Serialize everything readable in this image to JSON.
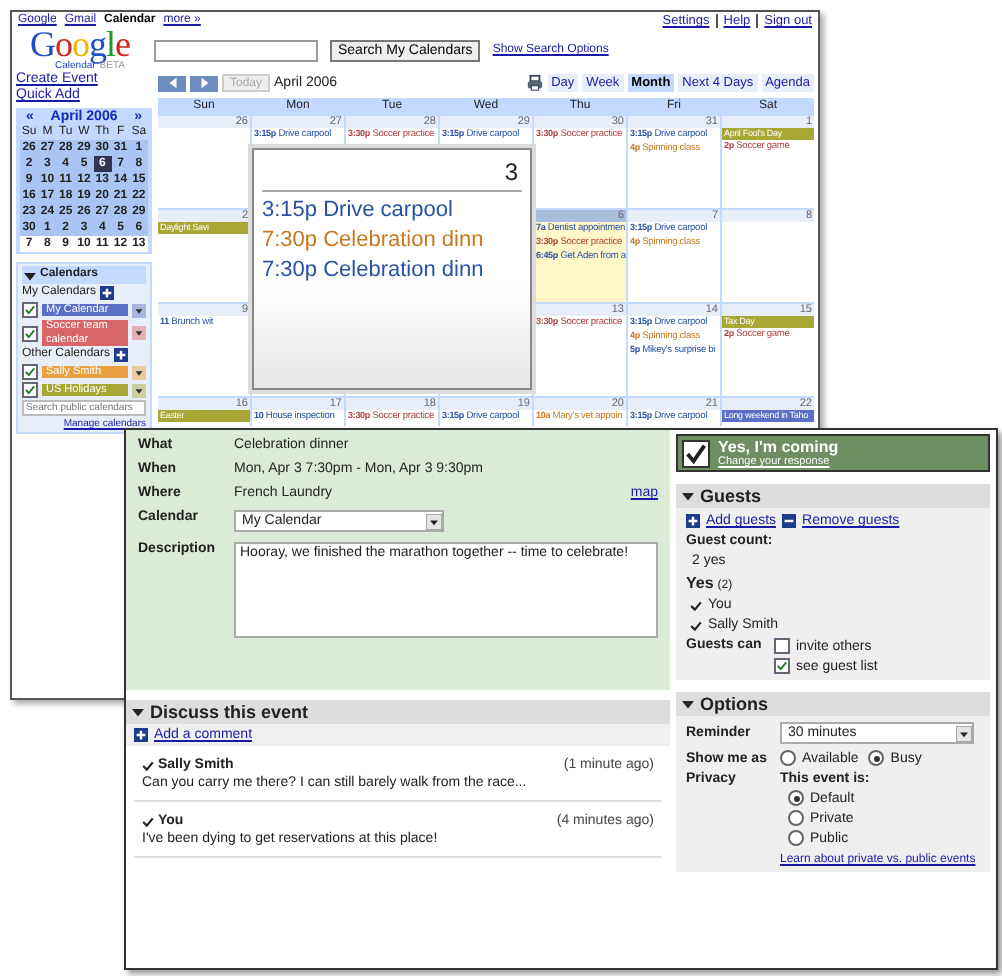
{
  "top_links": [
    {
      "label": "Google",
      "selected": false
    },
    {
      "label": "Gmail",
      "selected": false
    },
    {
      "label": "Calendar",
      "selected": true
    },
    {
      "label": "more »",
      "selected": false
    }
  ],
  "account_links": [
    "Settings",
    "Help",
    "Sign out"
  ],
  "logo": {
    "name": "Google",
    "subtitle": "Calendar",
    "badge": "BETA"
  },
  "search": {
    "button": "Search My Calendars",
    "options_link": "Show Search Options"
  },
  "actions": [
    "Create Event",
    "Quick Add"
  ],
  "mini_calendar": {
    "title": "April 2006",
    "prev": "«",
    "next": "»",
    "weekdays": [
      "Su",
      "M",
      "Tu",
      "W",
      "Th",
      "F",
      "Sa"
    ],
    "weeks": [
      [
        {
          "day": "26",
          "in_view": true,
          "selected": false
        },
        {
          "day": "27",
          "in_view": true,
          "selected": false
        },
        {
          "day": "28",
          "in_view": true,
          "selected": false
        },
        {
          "day": "29",
          "in_view": true,
          "selected": false
        },
        {
          "day": "30",
          "in_view": true,
          "selected": false
        },
        {
          "day": "31",
          "in_view": true,
          "selected": false
        },
        {
          "day": "1",
          "in_view": true,
          "selected": false
        }
      ],
      [
        {
          "day": "2",
          "in_view": true,
          "selected": false
        },
        {
          "day": "3",
          "in_view": true,
          "selected": false
        },
        {
          "day": "4",
          "in_view": true,
          "selected": false
        },
        {
          "day": "5",
          "in_view": true,
          "selected": false
        },
        {
          "day": "6",
          "in_view": true,
          "selected": true
        },
        {
          "day": "7",
          "in_view": true,
          "selected": false
        },
        {
          "day": "8",
          "in_view": true,
          "selected": false
        }
      ],
      [
        {
          "day": "9",
          "in_view": true,
          "selected": false
        },
        {
          "day": "10",
          "in_view": true,
          "selected": false
        },
        {
          "day": "11",
          "in_view": true,
          "selected": false
        },
        {
          "day": "12",
          "in_view": true,
          "selected": false
        },
        {
          "day": "13",
          "in_view": true,
          "selected": false
        },
        {
          "day": "14",
          "in_view": true,
          "selected": false
        },
        {
          "day": "15",
          "in_view": true,
          "selected": false
        }
      ],
      [
        {
          "day": "16",
          "in_view": true,
          "selected": false
        },
        {
          "day": "17",
          "in_view": true,
          "selected": false
        },
        {
          "day": "18",
          "in_view": true,
          "selected": false
        },
        {
          "day": "19",
          "in_view": true,
          "selected": false
        },
        {
          "day": "20",
          "in_view": true,
          "selected": false
        },
        {
          "day": "21",
          "in_view": true,
          "selected": false
        },
        {
          "day": "22",
          "in_view": true,
          "selected": false
        }
      ],
      [
        {
          "day": "23",
          "in_view": true,
          "selected": false
        },
        {
          "day": "24",
          "in_view": true,
          "selected": false
        },
        {
          "day": "25",
          "in_view": true,
          "selected": false
        },
        {
          "day": "26",
          "in_view": true,
          "selected": false
        },
        {
          "day": "27",
          "in_view": true,
          "selected": false
        },
        {
          "day": "28",
          "in_view": true,
          "selected": false
        },
        {
          "day": "29",
          "in_view": true,
          "selected": false
        }
      ],
      [
        {
          "day": "30",
          "in_view": true,
          "selected": false
        },
        {
          "day": "1",
          "in_view": true,
          "selected": false
        },
        {
          "day": "2",
          "in_view": true,
          "selected": false
        },
        {
          "day": "3",
          "in_view": true,
          "selected": false
        },
        {
          "day": "4",
          "in_view": true,
          "selected": false
        },
        {
          "day": "5",
          "in_view": true,
          "selected": false
        },
        {
          "day": "6",
          "in_view": true,
          "selected": false
        }
      ],
      [
        {
          "day": "7",
          "in_view": false,
          "selected": false
        },
        {
          "day": "8",
          "in_view": false,
          "selected": false
        },
        {
          "day": "9",
          "in_view": false,
          "selected": false
        },
        {
          "day": "10",
          "in_view": false,
          "selected": false
        },
        {
          "day": "11",
          "in_view": false,
          "selected": false
        },
        {
          "day": "12",
          "in_view": false,
          "selected": false
        },
        {
          "day": "13",
          "in_view": false,
          "selected": false
        }
      ]
    ]
  },
  "calendars": {
    "title": "Calendars",
    "expanded": true,
    "groups": [
      {
        "label": "My Calendars",
        "items": [
          {
            "name": "My Calendar",
            "color": "#5a6fc6",
            "checked": true
          },
          {
            "name": "Soccer team calendar",
            "color": "#d96666",
            "checked": true
          }
        ]
      },
      {
        "label": "Other Calendars",
        "items": [
          {
            "name": "Sally Smith",
            "color": "#e8a040",
            "checked": true
          },
          {
            "name": "US Holidays",
            "color": "#a7a735",
            "checked": true
          }
        ]
      }
    ],
    "search_placeholder": "Search public calendars",
    "manage_link": "Manage calendars"
  },
  "toolbar": {
    "today": "Today",
    "today_disabled": true,
    "period": "April 2006",
    "views": [
      {
        "label": "Day",
        "selected": false
      },
      {
        "label": "Week",
        "selected": false
      },
      {
        "label": "Month",
        "selected": true
      },
      {
        "label": "Next 4 Days",
        "selected": false
      },
      {
        "label": "Agenda",
        "selected": false
      }
    ]
  },
  "month": {
    "weekdays": [
      "Sun",
      "Mon",
      "Tue",
      "Wed",
      "Thu",
      "Fri",
      "Sat"
    ],
    "weeks": [
      {
        "days": [
          {
            "date": "26",
            "today": false
          },
          {
            "date": "27",
            "today": false,
            "events": [
              {
                "kind": "timed",
                "time": "3:15p",
                "title": "Drive carpool",
                "color": "#2952a3"
              }
            ]
          },
          {
            "date": "28",
            "today": false,
            "events": [
              {
                "kind": "timed",
                "time": "3:30p",
                "title": "Soccer practice",
                "color": "#b0413e"
              }
            ]
          },
          {
            "date": "29",
            "today": false,
            "events": [
              {
                "kind": "timed",
                "time": "3:15p",
                "title": "Drive carpool",
                "color": "#2952a3"
              }
            ]
          },
          {
            "date": "30",
            "today": false,
            "events": [
              {
                "kind": "timed",
                "time": "3:30p",
                "title": "Soccer practice",
                "color": "#b0413e"
              }
            ]
          },
          {
            "date": "31",
            "today": false,
            "events": [
              {
                "kind": "timed",
                "time": "3:15p",
                "title": "Drive carpool",
                "color": "#2952a3"
              },
              {
                "kind": "timed",
                "time": "4p",
                "title": "Spinning class",
                "color": "#c8781e"
              }
            ]
          },
          {
            "date": "1",
            "today": false,
            "events": [
              {
                "kind": "allday",
                "title": "April Fool's Day",
                "color": "#a7a735"
              },
              {
                "kind": "timed",
                "time": "2p",
                "title": "Soccer game",
                "color": "#b0413e"
              }
            ]
          }
        ]
      },
      {
        "days": [
          {
            "date": "2",
            "today": false,
            "events": [
              {
                "kind": "allday",
                "title": "Daylight Savi",
                "color": "#a7a735"
              }
            ]
          }
        ],
        "days_after": [
          {
            "date": "6",
            "today": true,
            "events": [
              {
                "kind": "timed",
                "time": "7a",
                "title": "Dentist appointmen",
                "color": "#2952a3"
              },
              {
                "kind": "timed",
                "time": "3:30p",
                "title": "Soccer practice",
                "color": "#b0413e"
              },
              {
                "kind": "timed",
                "time": "6:45p",
                "title": "Get Aden from a",
                "color": "#2952a3"
              }
            ]
          },
          {
            "date": "7",
            "today": false,
            "events": [
              {
                "kind": "timed",
                "time": "3:15p",
                "title": "Drive carpool",
                "color": "#2952a3"
              },
              {
                "kind": "timed",
                "time": "4p",
                "title": "Spinning class",
                "color": "#c8781e"
              }
            ]
          },
          {
            "date": "8",
            "today": false
          }
        ]
      },
      {
        "days": [
          {
            "date": "9",
            "today": false,
            "events": [
              {
                "kind": "timed",
                "time": "11",
                "title": "Brunch wit",
                "color": "#2952a3"
              }
            ]
          }
        ],
        "days_after": [
          {
            "date": "13",
            "today": false,
            "events": [
              {
                "kind": "timed",
                "time": "3:30p",
                "title": "Soccer practice",
                "color": "#b0413e"
              }
            ]
          },
          {
            "date": "14",
            "today": false,
            "events": [
              {
                "kind": "timed",
                "time": "3:15p",
                "title": "Drive carpool",
                "color": "#2952a3"
              },
              {
                "kind": "timed",
                "time": "4p",
                "title": "Spinning class",
                "color": "#c8781e"
              },
              {
                "kind": "timed",
                "time": "5p",
                "title": "Mikey's surprise bi",
                "color": "#2952a3"
              }
            ]
          },
          {
            "date": "15",
            "today": false,
            "events": [
              {
                "kind": "allday",
                "title": "Tax Day",
                "color": "#a7a735"
              },
              {
                "kind": "timed",
                "time": "2p",
                "title": "Soccer game",
                "color": "#b0413e"
              }
            ]
          }
        ]
      },
      {
        "days": [
          {
            "date": "16",
            "today": false,
            "events": [
              {
                "kind": "allday",
                "title": "Easter",
                "color": "#a7a735"
              }
            ]
          },
          {
            "date": "17",
            "today": false,
            "events": [
              {
                "kind": "timed",
                "time": "10",
                "title": "House inspection",
                "color": "#2952a3"
              }
            ]
          },
          {
            "date": "18",
            "today": false,
            "events": [
              {
                "kind": "timed",
                "time": "3:30p",
                "title": "Soccer practice",
                "color": "#b0413e"
              }
            ]
          },
          {
            "date": "19",
            "today": false,
            "events": [
              {
                "kind": "timed",
                "time": "3:15p",
                "title": "Drive carpool",
                "color": "#2952a3"
              }
            ]
          },
          {
            "date": "20",
            "today": false,
            "events": [
              {
                "kind": "timed",
                "time": "10a",
                "title": "Mary's vet appoin",
                "color": "#c8781e"
              }
            ]
          },
          {
            "date": "21",
            "today": false,
            "events": [
              {
                "kind": "timed",
                "time": "3:15p",
                "title": "Drive carpool",
                "color": "#2952a3"
              }
            ]
          },
          {
            "date": "22",
            "today": false,
            "events": [
              {
                "kind": "allday",
                "title": "Long weekend in Taho",
                "color": "#5a6fc6"
              }
            ]
          }
        ]
      }
    ]
  },
  "zoom_popover": {
    "date": "3",
    "events": [
      {
        "time": "3:15p",
        "title": "Drive carpool",
        "color": "#2952a3"
      },
      {
        "time": "7:30p",
        "title": "Celebration dinn",
        "color": "#c8781e"
      },
      {
        "time": "7:30p",
        "title": "Celebration dinn",
        "color": "#2952a3"
      }
    ]
  },
  "event": {
    "fields": [
      {
        "label": "What",
        "kind": "text",
        "value": "Celebration dinner"
      },
      {
        "label": "When",
        "kind": "text",
        "value": "Mon, Apr 3 7:30pm - Mon, Apr 3 9:30pm"
      },
      {
        "label": "Where",
        "kind": "text",
        "value": "French Laundry",
        "link": "map"
      },
      {
        "label": "Calendar",
        "kind": "select",
        "value": "My Calendar"
      },
      {
        "label": "Description",
        "kind": "textarea",
        "value": "Hooray, we finished the marathon together -- time to celebrate!"
      }
    ],
    "discussion": {
      "title": "Discuss this event",
      "expanded": true,
      "add_link": "Add a comment",
      "comments": [
        {
          "author": "Sally Smith",
          "time": "(1 minute ago)",
          "text": "Can you carry me there? I can still barely walk from the race..."
        },
        {
          "author": "You",
          "time": "(4 minutes ago)",
          "text": "I've been dying to get reservations at this place!"
        }
      ]
    },
    "rsvp": {
      "checked": true,
      "label": "Yes, I'm coming",
      "link": "Change your response"
    },
    "guests": {
      "title": "Guests",
      "expanded": true,
      "add_link": "Add guests",
      "remove_link": "Remove guests",
      "count_label": "Guest count:",
      "count": "2 yes",
      "yes_label": "Yes",
      "yes_count": "(2)",
      "list": [
        "You",
        "Sally Smith"
      ],
      "permissions_label": "Guests can",
      "permissions": [
        {
          "label": "invite others",
          "checked": false
        },
        {
          "label": "see guest list",
          "checked": true
        }
      ]
    },
    "options": {
      "title": "Options",
      "expanded": true,
      "reminder_label": "Reminder",
      "reminder": "30 minutes",
      "show_label": "Show me as",
      "show_options": [
        {
          "label": "Available",
          "selected": false
        },
        {
          "label": "Busy",
          "selected": true
        }
      ],
      "privacy_label": "Privacy",
      "privacy_heading": "This event is:",
      "privacy_options": [
        {
          "label": "Default",
          "selected": true
        },
        {
          "label": "Private",
          "selected": false
        },
        {
          "label": "Public",
          "selected": false
        }
      ],
      "learn_link": "Learn about private vs. public events"
    }
  }
}
